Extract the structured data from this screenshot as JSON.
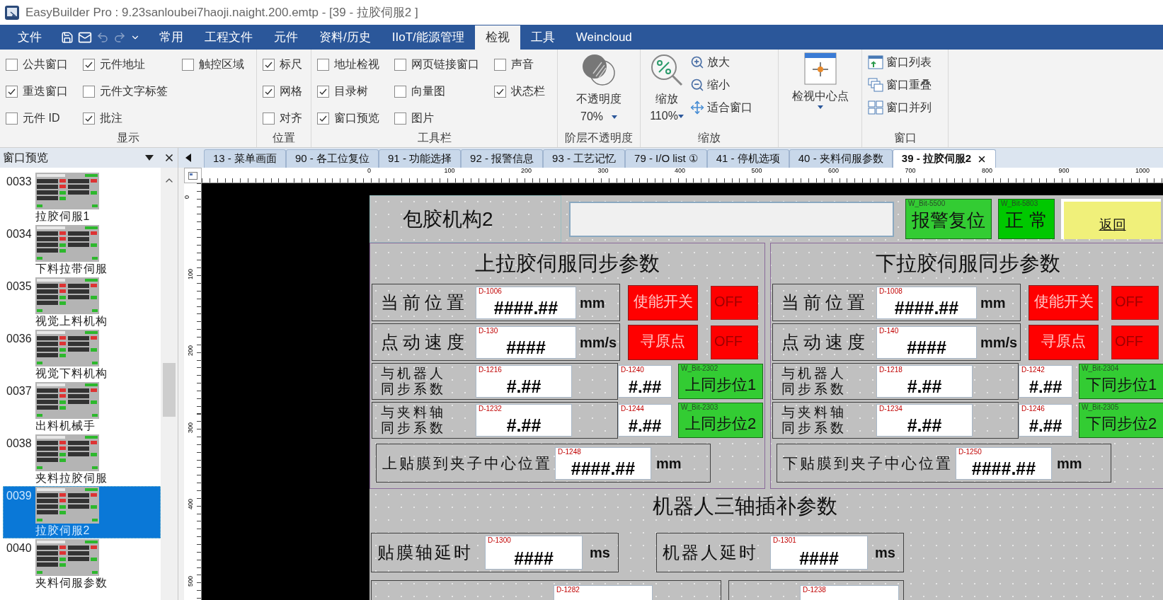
{
  "window": {
    "title": "EasyBuilder Pro : 9.23sanloubei7haoji.naight.200.emtp - [39 - 拉胶伺服2 ]"
  },
  "menu": [
    {
      "label": "文件",
      "selected": false
    },
    {
      "label": "常用",
      "selected": false
    },
    {
      "label": "工程文件",
      "selected": false
    },
    {
      "label": "元件",
      "selected": false
    },
    {
      "label": "资料/历史",
      "selected": false
    },
    {
      "label": "IIoT/能源管理",
      "selected": false
    },
    {
      "label": "检视",
      "selected": true
    },
    {
      "label": "工具",
      "selected": false
    },
    {
      "label": "Weincloud",
      "selected": false
    }
  ],
  "ribbon": [
    {
      "title": "显示",
      "kind": "checks",
      "items": [
        {
          "label": "公共窗口",
          "checked": false
        },
        {
          "label": "重迭窗口",
          "checked": true
        },
        {
          "label": "元件 ID",
          "checked": false
        },
        {
          "label": "元件地址",
          "checked": true
        },
        {
          "label": "元件文字标签",
          "checked": false
        },
        {
          "label": "批注",
          "checked": true
        },
        {
          "label": "触控区域",
          "checked": false
        }
      ]
    },
    {
      "title": "位置",
      "kind": "checks",
      "items": [
        {
          "label": "标尺",
          "checked": true
        },
        {
          "label": "网格",
          "checked": true
        },
        {
          "label": "对齐",
          "checked": false
        }
      ]
    },
    {
      "title": "工具栏",
      "kind": "checks",
      "items": [
        {
          "label": "地址检视",
          "checked": false
        },
        {
          "label": "目录树",
          "checked": true
        },
        {
          "label": "窗口预览",
          "checked": true
        },
        {
          "label": "网页链接窗口",
          "checked": false
        },
        {
          "label": "向量图",
          "checked": false
        },
        {
          "label": "图片",
          "checked": false
        },
        {
          "label": "声音",
          "checked": false
        },
        {
          "label": "状态栏",
          "checked": true
        }
      ]
    },
    {
      "title": "阶层不透明度",
      "kind": "opacity",
      "label": "不透明度",
      "value": "70%"
    },
    {
      "title": "缩放",
      "kind": "zoom",
      "label": "缩放",
      "value": "110%",
      "items": [
        {
          "label": "放大"
        },
        {
          "label": "缩小"
        },
        {
          "label": "适合窗口"
        }
      ]
    },
    {
      "kind": "center",
      "label": "检视中心点"
    },
    {
      "title": "窗口",
      "kind": "commands",
      "items": [
        {
          "label": "窗口列表"
        },
        {
          "label": "窗口重叠"
        },
        {
          "label": "窗口并列"
        }
      ]
    }
  ],
  "preview": {
    "title": "窗口预览",
    "items": [
      {
        "number": "0033",
        "name": "拉胶伺服1",
        "selected": false
      },
      {
        "number": "0034",
        "name": "下料拉带伺服",
        "selected": false
      },
      {
        "number": "0035",
        "name": "视觉上料机构",
        "selected": false
      },
      {
        "number": "0036",
        "name": "视觉下料机构",
        "selected": false
      },
      {
        "number": "0037",
        "name": "出料机械手",
        "selected": false
      },
      {
        "number": "0038",
        "name": "夹料拉胶伺服",
        "selected": false
      },
      {
        "number": "0039",
        "name": "拉胶伺服2",
        "selected": true
      },
      {
        "number": "0040",
        "name": "夹料伺服参数",
        "selected": false
      }
    ]
  },
  "tabs": [
    {
      "label": "13 - 菜单画面",
      "selected": false
    },
    {
      "label": "90 - 各工位复位",
      "selected": false
    },
    {
      "label": "91 - 功能选择",
      "selected": false
    },
    {
      "label": "92 - 报警信息",
      "selected": false
    },
    {
      "label": "93 - 工艺记忆",
      "selected": false
    },
    {
      "label": "79 - I/O list ①",
      "selected": false
    },
    {
      "label": "41 - 停机选项",
      "selected": false
    },
    {
      "label": "40 - 夹料伺服参数",
      "selected": false
    },
    {
      "label": "39 - 拉胶伺服2",
      "selected": true
    }
  ],
  "rulers": {
    "horizontal": [
      "0",
      "100",
      "200",
      "300",
      "400",
      "500",
      "600",
      "700",
      "800",
      "900",
      "1000"
    ],
    "vertical": [
      "0",
      "100",
      "200",
      "300",
      "400",
      "500"
    ]
  },
  "hmi": {
    "title": "包胶机构2",
    "top_buttons": [
      {
        "kind": "alarm",
        "tag": "W_Bit-5500",
        "label": "报警复位"
      },
      {
        "kind": "status",
        "tag": "W_Bit-5803",
        "label": "正 常"
      },
      {
        "kind": "back",
        "label": "返回"
      }
    ],
    "sections": [
      {
        "title": "上拉胶伺服同步参数",
        "rows": [
          {
            "kind": "value",
            "label": "当前位置",
            "address": "D-1006",
            "value": "####.##",
            "unit": "mm",
            "button": "使能开关",
            "state": "OFF"
          },
          {
            "kind": "value",
            "label": "点动速度",
            "address": "D-130",
            "value": "####",
            "unit": "mm/s",
            "button": "寻原点",
            "state": "OFF"
          },
          {
            "kind": "sync",
            "label_lines": [
              "与机器人",
              "同步系数"
            ],
            "address": "D-1216",
            "value": "#.##",
            "aux_address": "D-1240",
            "aux_value": "#.##",
            "tag": "W_Bit-2302",
            "button": "上同步位1"
          },
          {
            "kind": "sync",
            "label_lines": [
              "与夹料轴",
              "同步系数"
            ],
            "address": "D-1232",
            "value": "#.##",
            "aux_address": "D-1244",
            "aux_value": "#.##",
            "tag": "W_Bit-2303",
            "button": "上同步位2"
          }
        ],
        "offset": {
          "label": "上贴膜到夹子中心位置",
          "address": "D-1248",
          "value": "####.##",
          "unit": "mm"
        }
      },
      {
        "title": "下拉胶伺服同步参数",
        "rows": [
          {
            "kind": "value",
            "label": "当前位置",
            "address": "D-1008",
            "value": "####.##",
            "unit": "mm",
            "button": "使能开关",
            "state": "OFF"
          },
          {
            "kind": "value",
            "label": "点动速度",
            "address": "D-140",
            "value": "####",
            "unit": "mm/s",
            "button": "寻原点",
            "state": "OFF"
          },
          {
            "kind": "sync",
            "label_lines": [
              "与机器人",
              "同步系数"
            ],
            "address": "D-1218",
            "value": "#.##",
            "aux_address": "D-1242",
            "aux_value": "#.##",
            "tag": "W_Bit-2304",
            "button": "下同步位1"
          },
          {
            "kind": "sync",
            "label_lines": [
              "与夹料轴",
              "同步系数"
            ],
            "address": "D-1234",
            "value": "#.##",
            "aux_address": "D-1246",
            "aux_value": "#.##",
            "tag": "W_Bit-2305",
            "button": "下同步位2"
          }
        ],
        "offset": {
          "label": "下贴膜到夹子中心位置",
          "address": "D-1250",
          "value": "####.##",
          "unit": "mm"
        }
      }
    ],
    "interp": {
      "title": "机器人三轴插补参数",
      "rows": [
        {
          "label": "贴膜轴延时",
          "address": "D-1300",
          "value": "####",
          "unit": "ms"
        },
        {
          "label": "机器人延时",
          "address": "D-1301",
          "value": "####",
          "unit": "ms"
        }
      ],
      "cut_rows": [
        {
          "address": "D-1282"
        },
        {
          "address": "D-1238"
        }
      ]
    }
  }
}
